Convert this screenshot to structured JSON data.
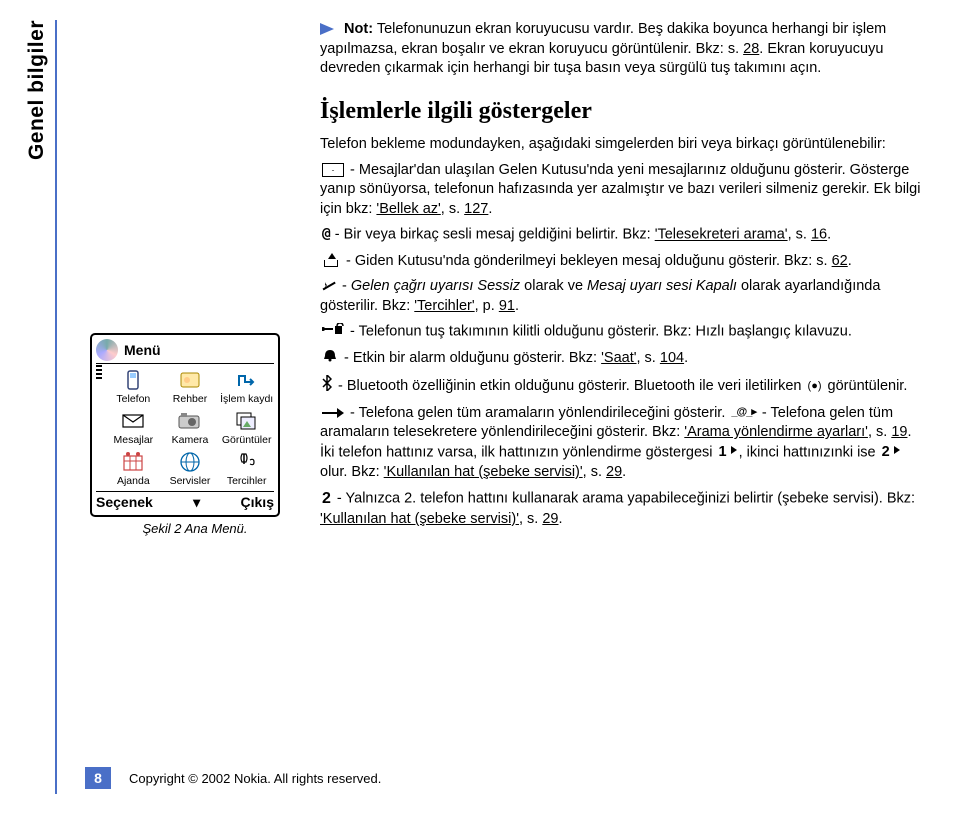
{
  "side_label": "Genel bilgiler",
  "note": {
    "label": "Not:",
    "p1": "Telefonunuzun ekran koruyucusu vardır. Beş dakika boyunca herhangi bir işlem yapılmazsa, ekran boşalır ve ekran koruyucu görüntülenir. Bkz: s. ",
    "p1_link": "28",
    "p1_after": ". Ekran koruyucuyu devreden çıkarmak için herhangi bir tuşa basın veya sürgülü tuş takımını açın."
  },
  "heading": "İşlemlerle ilgili göstergeler",
  "intro": "Telefon bekleme modundayken, aşağıdaki simgelerden biri veya birkaçı görüntülenebilir:",
  "items": {
    "env": {
      "t1": " - Mesajlar'dan ulaşılan Gelen Kutusu'nda yeni mesajlarınız olduğunu gösterir. Gösterge yanıp sönüyorsa, telefonun hafızasında yer azalmıştır ve bazı verileri silmeniz gerekir. Ek bilgi için bkz: ",
      "l1": "'Bellek az'",
      "t2": ", s. ",
      "l2": "127",
      "t3": "."
    },
    "vm": {
      "t1": " - Bir veya birkaç sesli mesaj geldiğini belirtir. Bkz: ",
      "l1": "'Telesekreteri arama'",
      "t2": ", s. ",
      "l2": "16",
      "t3": "."
    },
    "out": {
      "t1": " - Giden Kutusu'nda gönderilmeyi bekleyen mesaj olduğunu gösterir. Bkz: s. ",
      "l1": "62",
      "t2": "."
    },
    "sil": {
      "t1": " - ",
      "i1": "Gelen çağrı uyarısı Sessiz",
      "t2": " olarak ve ",
      "i2": "Mesaj uyarı sesi Kapalı",
      "t3": " olarak ayarlandığında gösterilir. Bkz: ",
      "l1": "'Tercihler'",
      "t4": ", p. ",
      "l2": "91",
      "t5": "."
    },
    "lock": " - Telefonun tuş takımının kilitli olduğunu gösterir. Bkz: Hızlı başlangıç kılavuzu.",
    "alarm": {
      "t1": " - Etkin bir alarm olduğunu gösterir. Bkz: ",
      "l1": "'Saat'",
      "t2": ", s. ",
      "l2": "104",
      "t3": "."
    },
    "bt": " - Bluetooth özelliğinin etkin olduğunu gösterir. Bluetooth ile veri iletilirken ",
    "bt2": " görüntülenir.",
    "fwd": {
      "t1": " - Telefona gelen tüm aramaların yönlendirileceğini gösterir. ",
      "t2": " - Telefona gelen tüm aramaların telesekretere yönlendirileceğini gösterir. Bkz: ",
      "l1": "'Arama yönlendirme ayarları'",
      "t3": ", s. ",
      "l2": "19",
      "t4": ". İki telefon hattınız varsa, ilk hattınızın yönlendirme göstergesi ",
      "t5": ", ikinci hattınızınki ise ",
      "t6": " olur. Bkz: ",
      "l3": "'Kullanılan hat (şebeke servisi)'",
      "t7": ", s. ",
      "l4": "29",
      "t8": "."
    },
    "two": {
      "t1": " - Yalnızca 2. telefon hattını kullanarak arama yapabileceğinizi belirtir (şebeke servisi). Bkz: ",
      "l1": "'Kullanılan hat (şebeke servisi)'",
      "t2": ", s. ",
      "l2": "29",
      "t3": "."
    }
  },
  "phone": {
    "menu": "Menü",
    "apps": [
      "Telefon",
      "Rehber",
      "İşlem kaydı",
      "Mesajlar",
      "Kamera",
      "Görüntüler",
      "Ajanda",
      "Servisler",
      "Tercihler"
    ],
    "left": "Seçenek",
    "right": "Çıkış",
    "caption": "Şekil 2 Ana Menü."
  },
  "footer": {
    "page": "8",
    "copy": "Copyright © 2002 Nokia. All rights reserved."
  }
}
